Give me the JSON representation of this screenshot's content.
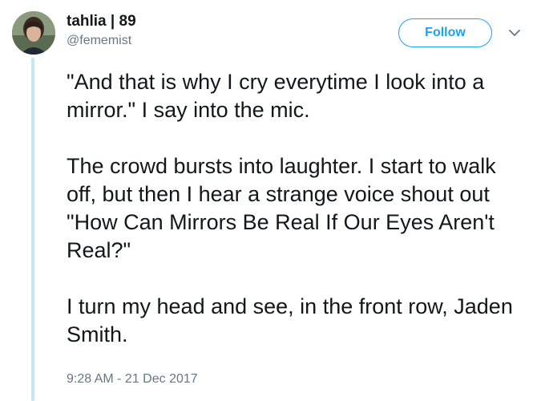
{
  "tweet": {
    "author": {
      "display_name": "tahlia | 89",
      "handle": "@fememist"
    },
    "follow_label": "Follow",
    "paragraphs": [
      "\"And that is why I cry everytime I look into a mirror.\" I say into the mic.",
      "The crowd bursts into laughter. I start to walk off, but then I hear a strange voice shout out \"How Can Mirrors Be Real If Our Eyes Aren't Real?\"",
      "I turn my head and see, in the front row, Jaden Smith."
    ],
    "timestamp": "9:28 AM - 21 Dec 2017"
  },
  "icons": {
    "menu": "chevron-down-icon",
    "avatar": "profile-photo"
  },
  "colors": {
    "accent": "#1da1f2",
    "secondary_text": "#657786",
    "thread_line": "#c4e6f5",
    "text": "#14171a"
  }
}
